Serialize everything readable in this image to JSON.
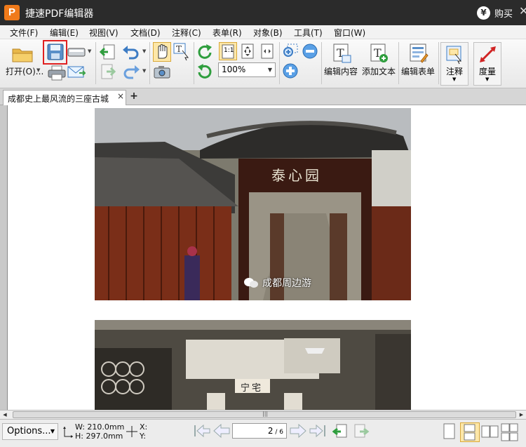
{
  "window": {
    "app_logo": "P",
    "title": "捷速PDF编辑器",
    "buy_label": "购买",
    "buy_icon": "¥",
    "close_glyph": "✕"
  },
  "menu": [
    {
      "name": "file",
      "label": "文件(F)"
    },
    {
      "name": "edit",
      "label": "编辑(E)"
    },
    {
      "name": "view",
      "label": "视图(V)"
    },
    {
      "name": "document",
      "label": "文档(D)"
    },
    {
      "name": "annotate",
      "label": "注释(C)"
    },
    {
      "name": "form",
      "label": "表单(R)"
    },
    {
      "name": "object",
      "label": "对象(B)"
    },
    {
      "name": "tools",
      "label": "工具(T)"
    },
    {
      "name": "window",
      "label": "窗口(W)"
    }
  ],
  "toolbar": {
    "open_label": "打开(O)...",
    "zoom_value": "100%",
    "actual_size_label": "1:1",
    "edit_content_label": "编辑内容",
    "add_text_label": "添加文本",
    "edit_form_label": "编辑表单",
    "annotate_label": "注释",
    "measure_label": "度量"
  },
  "tabs": {
    "active_title": "成都史上最风流的三座古城",
    "close_glyph": "×",
    "new_tab_glyph": "+"
  },
  "document": {
    "watermark_text": "成都周边游",
    "sign_top": "泰心园",
    "sign_bottom": "宁宅"
  },
  "status": {
    "options_label": "Options...",
    "width_label": "W: 210.0mm",
    "height_label": "H: 297.0mm",
    "x_label": "X:",
    "y_label": "Y:",
    "current_page": "2",
    "total_pages": "6"
  },
  "colors": {
    "titlebar": "#2b2b2b",
    "logo": "#f07a1a",
    "highlight": "#e02020"
  }
}
